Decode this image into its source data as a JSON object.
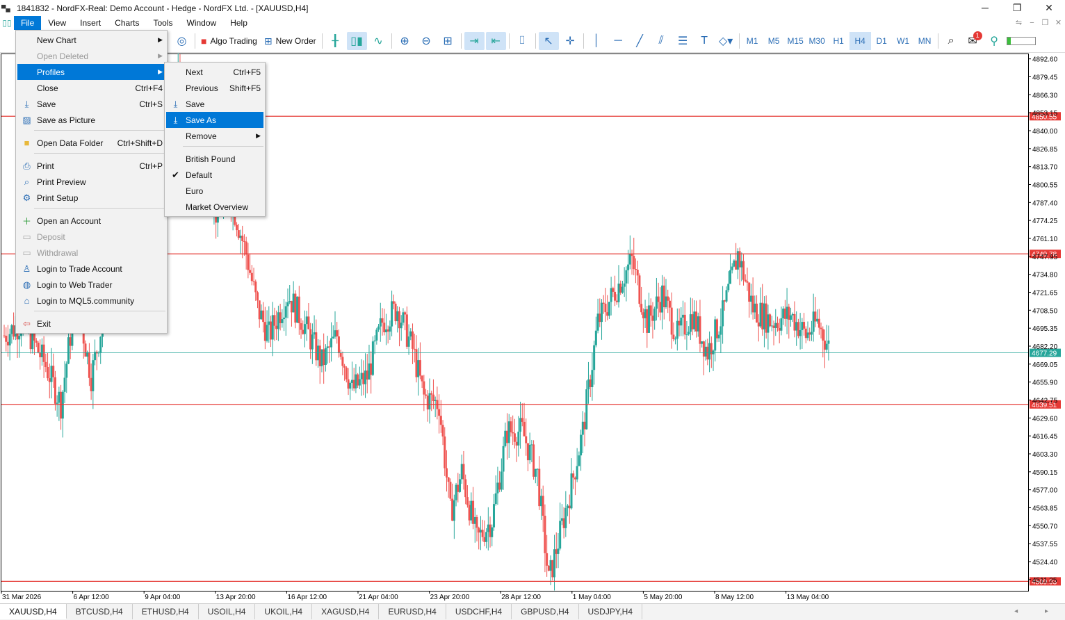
{
  "window": {
    "title": "1841832 - NordFX-Real: Demo Account - Hedge - NordFX Ltd. - [XAUUSD,H4]",
    "minimize": "─",
    "restore": "❐",
    "close": "✕"
  },
  "menubar": {
    "items": [
      "File",
      "View",
      "Insert",
      "Charts",
      "Tools",
      "Window",
      "Help"
    ],
    "mdi": [
      "⇋",
      "−",
      "❐",
      "✕"
    ]
  },
  "toolbar": {
    "algo_trading": "Algo Trading",
    "new_order": "New Order",
    "timeframes": [
      "M1",
      "M5",
      "M15",
      "M30",
      "H1",
      "H4",
      "D1",
      "W1",
      "MN"
    ],
    "selected_timeframe": "H4",
    "notification_count": "1"
  },
  "file_menu": {
    "items": [
      {
        "label": "New Chart",
        "submenu": true,
        "icon": "none"
      },
      {
        "label": "Open Deleted",
        "submenu": true,
        "disabled": true,
        "icon": "none"
      },
      {
        "label": "Profiles",
        "submenu": true,
        "highlighted": true,
        "icon": "none"
      },
      {
        "label": "Close",
        "shortcut": "Ctrl+F4",
        "icon": "none"
      },
      {
        "label": "Save",
        "shortcut": "Ctrl+S",
        "icon": "save-icon"
      },
      {
        "label": "Save as Picture",
        "icon": "picture-icon"
      },
      {
        "label": "Open Data Folder",
        "shortcut": "Ctrl+Shift+D",
        "icon": "folder-icon"
      },
      {
        "label": "Print",
        "shortcut": "Ctrl+P",
        "icon": "print-icon"
      },
      {
        "label": "Print Preview",
        "icon": "print-preview-icon"
      },
      {
        "label": "Print Setup",
        "icon": "print-setup-icon"
      },
      {
        "label": "Open an Account",
        "icon": "plus-icon"
      },
      {
        "label": "Deposit",
        "disabled": true,
        "icon": "deposit-icon"
      },
      {
        "label": "Withdrawal",
        "disabled": true,
        "icon": "withdrawal-icon"
      },
      {
        "label": "Login to Trade Account",
        "icon": "user-icon"
      },
      {
        "label": "Login to Web Trader",
        "icon": "globe-icon"
      },
      {
        "label": "Login to MQL5.community",
        "icon": "mql5-icon"
      },
      {
        "label": "Exit",
        "icon": "exit-icon"
      }
    ]
  },
  "profiles_menu": {
    "items": [
      {
        "label": "Next",
        "shortcut": "Ctrl+F5"
      },
      {
        "label": "Previous",
        "shortcut": "Shift+F5"
      },
      {
        "label": "Save",
        "icon": "save-icon"
      },
      {
        "label": "Save As",
        "highlighted": true,
        "icon": "save-icon"
      },
      {
        "label": "Remove",
        "submenu": true
      },
      {
        "label": "British Pound"
      },
      {
        "label": "Default",
        "checked": true
      },
      {
        "label": "Euro"
      },
      {
        "label": "Market Overview"
      }
    ]
  },
  "chart_data": {
    "type": "candlestick",
    "symbol": "XAUUSD",
    "timeframe": "H4",
    "price_axis_ticks": [
      "4892.60",
      "4879.45",
      "4866.30",
      "4853.15",
      "4840.00",
      "4826.85",
      "4813.70",
      "4800.55",
      "4787.40",
      "4774.25",
      "4761.10",
      "4747.95",
      "4734.80",
      "4721.65",
      "4708.50",
      "4695.35",
      "4682.20",
      "4669.05",
      "4655.90",
      "4642.75",
      "4629.60",
      "4616.45",
      "4603.30",
      "4590.15",
      "4577.00",
      "4563.85",
      "4550.70",
      "4537.55",
      "4524.40",
      "4511.25"
    ],
    "time_axis_ticks": [
      "31 Mar 2026",
      "6 Apr 12:00",
      "9 Apr 04:00",
      "13 Apr 20:00",
      "16 Apr 12:00",
      "21 Apr 04:00",
      "23 Apr 20:00",
      "28 Apr 12:00",
      "1 May 04:00",
      "5 May 20:00",
      "8 May 12:00",
      "13 May 04:00"
    ],
    "levels": [
      {
        "price": 4850.55,
        "label": "4850.55",
        "color": "#e53935"
      },
      {
        "price": 4749.78,
        "label": "4749.78",
        "color": "#e53935"
      },
      {
        "price": 4639.51,
        "label": "4639.51",
        "color": "#e53935"
      },
      {
        "price": 4509.93,
        "label": "4509.93",
        "color": "#e53935"
      }
    ],
    "bid": {
      "price": 4677.29,
      "label": "4677.29",
      "color": "#26a69a"
    },
    "ylim": [
      4503,
      4896
    ],
    "colors": {
      "bull": "#26a69a",
      "bear": "#ef5350"
    },
    "waypoints": [
      [
        0,
        4690
      ],
      [
        10,
        4700
      ],
      [
        22,
        4668
      ],
      [
        30,
        4640
      ],
      [
        38,
        4720
      ],
      [
        46,
        4660
      ],
      [
        52,
        4700
      ],
      [
        62,
        4780
      ],
      [
        70,
        4760
      ],
      [
        78,
        4820
      ],
      [
        86,
        4835
      ],
      [
        92,
        4878
      ],
      [
        96,
        4855
      ],
      [
        104,
        4830
      ],
      [
        112,
        4780
      ],
      [
        120,
        4790
      ],
      [
        128,
        4750
      ],
      [
        134,
        4710
      ],
      [
        140,
        4690
      ],
      [
        150,
        4720
      ],
      [
        158,
        4700
      ],
      [
        168,
        4670
      ],
      [
        176,
        4690
      ],
      [
        184,
        4650
      ],
      [
        192,
        4660
      ],
      [
        200,
        4700
      ],
      [
        208,
        4710
      ],
      [
        216,
        4680
      ],
      [
        222,
        4645
      ],
      [
        230,
        4640
      ],
      [
        236,
        4560
      ],
      [
        242,
        4590
      ],
      [
        250,
        4540
      ],
      [
        258,
        4555
      ],
      [
        266,
        4620
      ],
      [
        274,
        4620
      ],
      [
        282,
        4588
      ],
      [
        288,
        4510
      ],
      [
        294,
        4545
      ],
      [
        300,
        4580
      ],
      [
        306,
        4620
      ],
      [
        314,
        4700
      ],
      [
        322,
        4720
      ],
      [
        332,
        4745
      ],
      [
        340,
        4700
      ],
      [
        348,
        4720
      ],
      [
        356,
        4690
      ],
      [
        364,
        4705
      ],
      [
        372,
        4678
      ],
      [
        380,
        4705
      ],
      [
        388,
        4750
      ],
      [
        396,
        4710
      ],
      [
        406,
        4700
      ],
      [
        416,
        4705
      ],
      [
        424,
        4690
      ],
      [
        430,
        4700
      ],
      [
        436,
        4682
      ]
    ]
  },
  "tabs": [
    "XAUUSD,H4",
    "BTCUSD,H4",
    "ETHUSD,H4",
    "USOIL,H4",
    "UKOIL,H4",
    "XAGUSD,H4",
    "EURUSD,H4",
    "USDCHF,H4",
    "GBPUSD,H4",
    "USDJPY,H4"
  ],
  "tab_scroll": "◂ ▸"
}
